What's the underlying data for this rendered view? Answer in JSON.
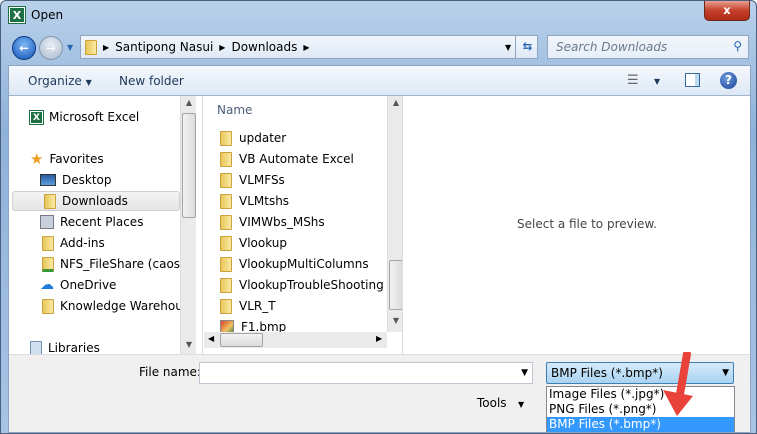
{
  "window": {
    "title": "Open",
    "close_label": "x"
  },
  "address": {
    "path": [
      "Santipong Nasui",
      "Downloads"
    ],
    "search_placeholder": "Search Downloads"
  },
  "toolbar": {
    "organize": "Organize",
    "new_folder": "New folder"
  },
  "nav": {
    "items": [
      {
        "label": "Microsoft Excel",
        "icon": "excel-icon"
      },
      {
        "label": "Favorites",
        "icon": "star-icon"
      },
      {
        "label": "Desktop",
        "icon": "desktop-icon"
      },
      {
        "label": "Downloads",
        "icon": "downloads-folder-icon",
        "selected": true
      },
      {
        "label": "Recent Places",
        "icon": "recent-places-icon"
      },
      {
        "label": "Add-ins",
        "icon": "folder-icon"
      },
      {
        "label": "NFS_FileShare (caosdfs",
        "icon": "network-folder-icon"
      },
      {
        "label": "OneDrive",
        "icon": "onedrive-icon"
      },
      {
        "label": "Knowledge Warehouse",
        "icon": "folder-icon"
      },
      {
        "label": "Libraries",
        "icon": "libraries-icon"
      }
    ]
  },
  "files": {
    "column_header": "Name",
    "items": [
      {
        "name": "updater",
        "type": "folder"
      },
      {
        "name": "VB Automate Excel",
        "type": "folder"
      },
      {
        "name": "VLMFSs",
        "type": "folder"
      },
      {
        "name": "VLMtshs",
        "type": "folder"
      },
      {
        "name": "VIMWbs_MShs",
        "type": "folder"
      },
      {
        "name": "Vlookup",
        "type": "folder"
      },
      {
        "name": "VlookupMultiColumns",
        "type": "folder"
      },
      {
        "name": "VlookupTroubleShooting",
        "type": "folder"
      },
      {
        "name": "VLR_T",
        "type": "folder"
      },
      {
        "name": "F1.bmp",
        "type": "bmp"
      }
    ]
  },
  "preview": {
    "text": "Select a file to preview."
  },
  "bottom": {
    "file_name_label": "File name:",
    "file_name_value": "",
    "filter_selected": "BMP Files (*.bmp*)",
    "filter_options": [
      "Image Files (*.jpg*)",
      "PNG Files (*.png*)",
      "BMP Files (*.bmp*)"
    ],
    "tools_label": "Tools"
  },
  "colors": {
    "selection": "#3399ff",
    "annotation_arrow": "#e8423a"
  }
}
